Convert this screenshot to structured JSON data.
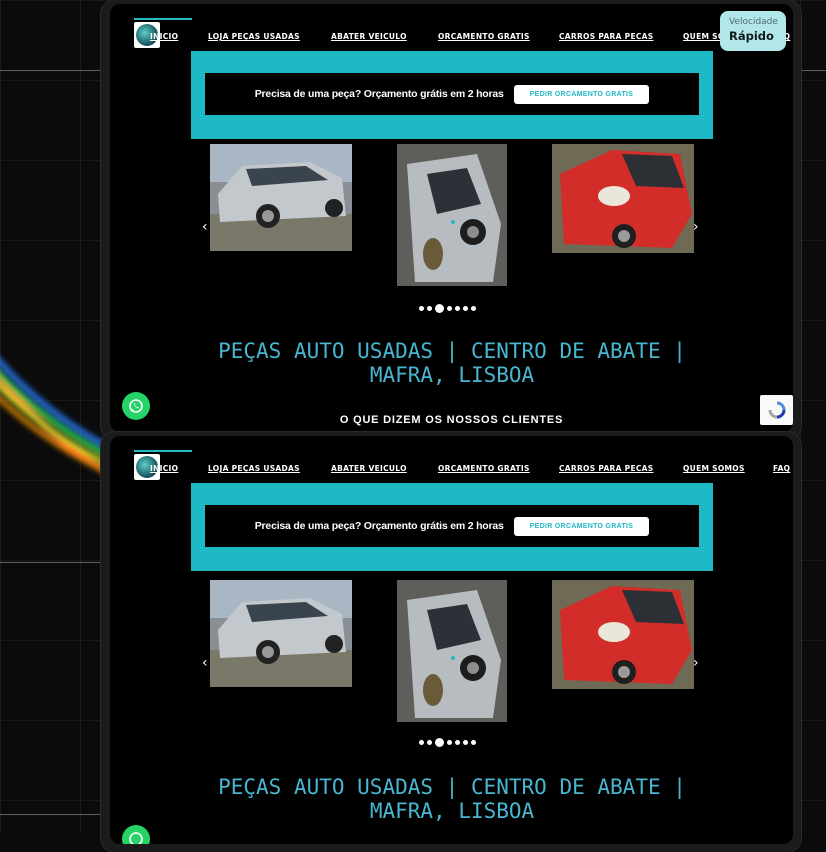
{
  "nav": {
    "items": [
      "INICIO",
      "LOJA PEÇAS USADAS",
      "ABATER VEICULO",
      "ORCAMENTO GRATIS",
      "CARROS PARA PECAS",
      "QUEM SOMOS",
      "FAQ"
    ]
  },
  "banner": {
    "text": "Precisa de uma peça? Orçamento grátis em 2 horas",
    "button": "PEDIR ORCAMENTO GRATIS"
  },
  "headline": {
    "line1": "PEÇAS AUTO USADAS | CENTRO DE ABATE |",
    "line2": "MAFRA, LISBOA"
  },
  "testimonials_heading": "O QUE DIZEM OS NOSSOS CLIENTES",
  "carousel": {
    "slides": [
      "silver-minivan",
      "silver-hatchback",
      "red-citroen"
    ],
    "dot_count": 7,
    "active_dot": 2
  },
  "speed_widget": {
    "label": "Velocidade",
    "value": "Rápido"
  },
  "colors": {
    "accent": "#1fb8c5",
    "headline": "#48b6d0",
    "whatsapp": "#25d366"
  }
}
